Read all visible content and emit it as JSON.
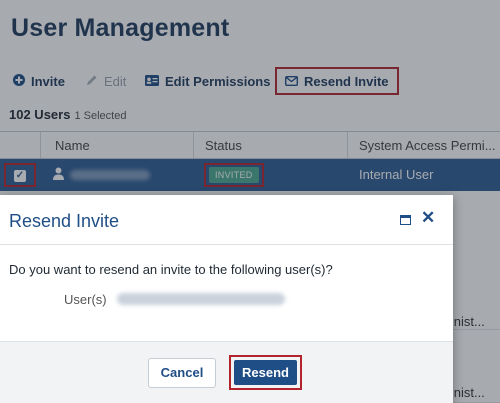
{
  "page": {
    "title": "User Management"
  },
  "toolbar": {
    "invite": "Invite",
    "edit": "Edit",
    "edit_permissions": "Edit Permissions",
    "resend_invite": "Resend Invite"
  },
  "summary": {
    "users": "102 Users",
    "selected": "1 Selected"
  },
  "table": {
    "columns": [
      "Name",
      "Status",
      "System Access Permi..."
    ],
    "selected_row": {
      "status": "INVITED",
      "access": "Internal User"
    },
    "partial_rows": [
      "...inist...",
      "...inist..."
    ]
  },
  "dialog": {
    "title": "Resend Invite",
    "question": "Do you want to resend an invite to the following user(s)?",
    "user_label": "User(s)",
    "cancel": "Cancel",
    "resend": "Resend"
  },
  "colors": {
    "brand": "#1f4e86",
    "selected_row": "#2d5c93",
    "status_invited": "#4ba88f",
    "highlight": "#b3232c"
  },
  "icons": [
    "plus-circle-icon",
    "pencil-icon",
    "id-card-icon",
    "envelope-icon",
    "user-icon",
    "maximize-icon",
    "close-icon"
  ]
}
